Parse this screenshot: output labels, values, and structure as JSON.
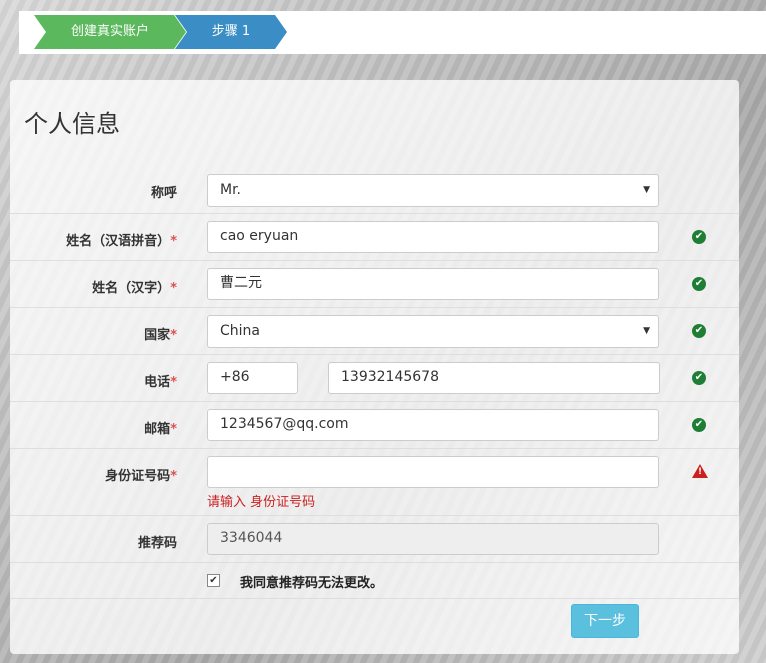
{
  "steps": {
    "step1": "创建真实账户",
    "step2": "步骤 1"
  },
  "panel": {
    "title": "个人信息"
  },
  "form": {
    "salutation": {
      "label": "称呼",
      "value": "Mr."
    },
    "name_pinyin": {
      "label": "姓名（汉语拼音）",
      "required": "*",
      "value": "cao eryuan"
    },
    "name_hanzi": {
      "label": "姓名（汉字）",
      "required": "*",
      "value": "曹二元"
    },
    "country": {
      "label": "国家",
      "required": "*",
      "value": "China"
    },
    "phone": {
      "label": "电话",
      "required": "*",
      "code": "+86",
      "value": "13932145678"
    },
    "email": {
      "label": "邮箱",
      "required": "*",
      "value": "1234567@qq.com"
    },
    "id_number": {
      "label": "身份证号码",
      "required": "*",
      "value": "",
      "error": "请输入 身份证号码"
    },
    "referral": {
      "label": "推荐码",
      "value": "3346044"
    },
    "agree": {
      "label": "我同意推荐码无法更改。",
      "checked": "✔"
    }
  },
  "buttons": {
    "next": "下一步"
  },
  "icons": {
    "ok": "✔",
    "warn": "!"
  },
  "colors": {
    "step_green": "#5cb85c",
    "step_blue": "#3a8dc5",
    "ok_green": "#1e7e34",
    "error_red": "#cc1f1f",
    "button_info": "#5bc0de"
  }
}
